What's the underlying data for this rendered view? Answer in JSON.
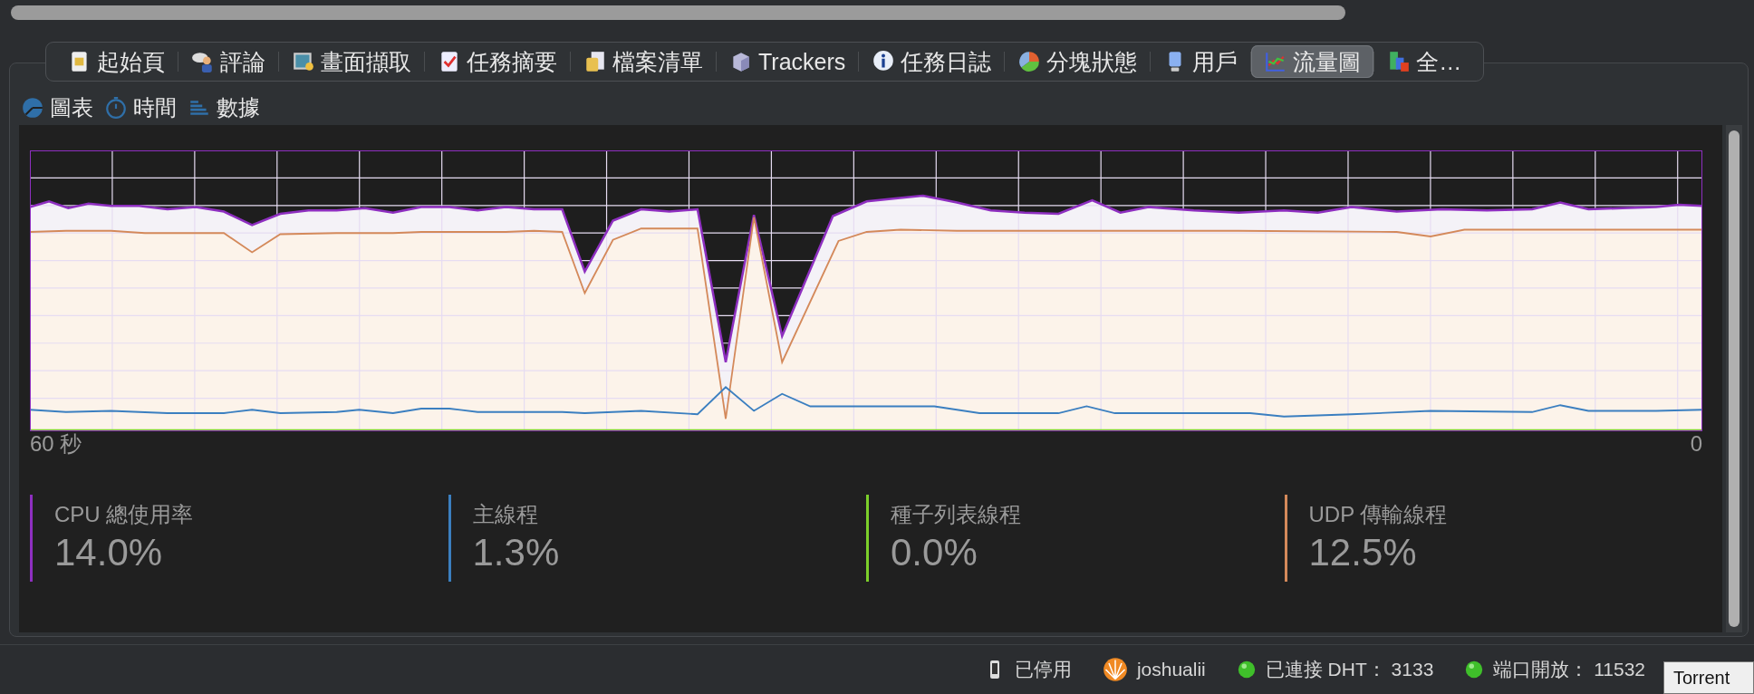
{
  "tabs": [
    {
      "label": "起始頁",
      "selected": false
    },
    {
      "label": "評論",
      "selected": false
    },
    {
      "label": "畫面擷取",
      "selected": false
    },
    {
      "label": "任務摘要",
      "selected": false
    },
    {
      "label": "檔案清單",
      "selected": false
    },
    {
      "label": "Trackers",
      "selected": false
    },
    {
      "label": "任務日誌",
      "selected": false
    },
    {
      "label": "分塊狀態",
      "selected": false
    },
    {
      "label": "用戶",
      "selected": false
    },
    {
      "label": "流量圖",
      "selected": true
    },
    {
      "label": "全…",
      "selected": false
    }
  ],
  "view_tabs": [
    {
      "label": "圖表",
      "selected": false
    },
    {
      "label": "時間",
      "selected": false
    },
    {
      "label": "數據",
      "selected": false
    }
  ],
  "chart": {
    "x_start_label": "60 秒",
    "x_end_label": "0"
  },
  "legend": [
    {
      "label": "CPU 總使用率",
      "value": "14.0%",
      "color": "#8e2fc0"
    },
    {
      "label": "主線程",
      "value": "1.3%",
      "color": "#3b7fc0"
    },
    {
      "label": "種子列表線程",
      "value": "0.0%",
      "color": "#7ccf2a"
    },
    {
      "label": "UDP 傳輸線程",
      "value": "12.5%",
      "color": "#d4895a"
    }
  ],
  "status_bar": [
    {
      "kind": "phone",
      "text": "已停用"
    },
    {
      "kind": "logo",
      "text": "joshualii"
    },
    {
      "kind": "dot",
      "text": "已連接 DHT： 3133"
    },
    {
      "kind": "dot",
      "text": "端口開放： 11532"
    }
  ],
  "tooltip": {
    "text": "Torrent"
  }
}
